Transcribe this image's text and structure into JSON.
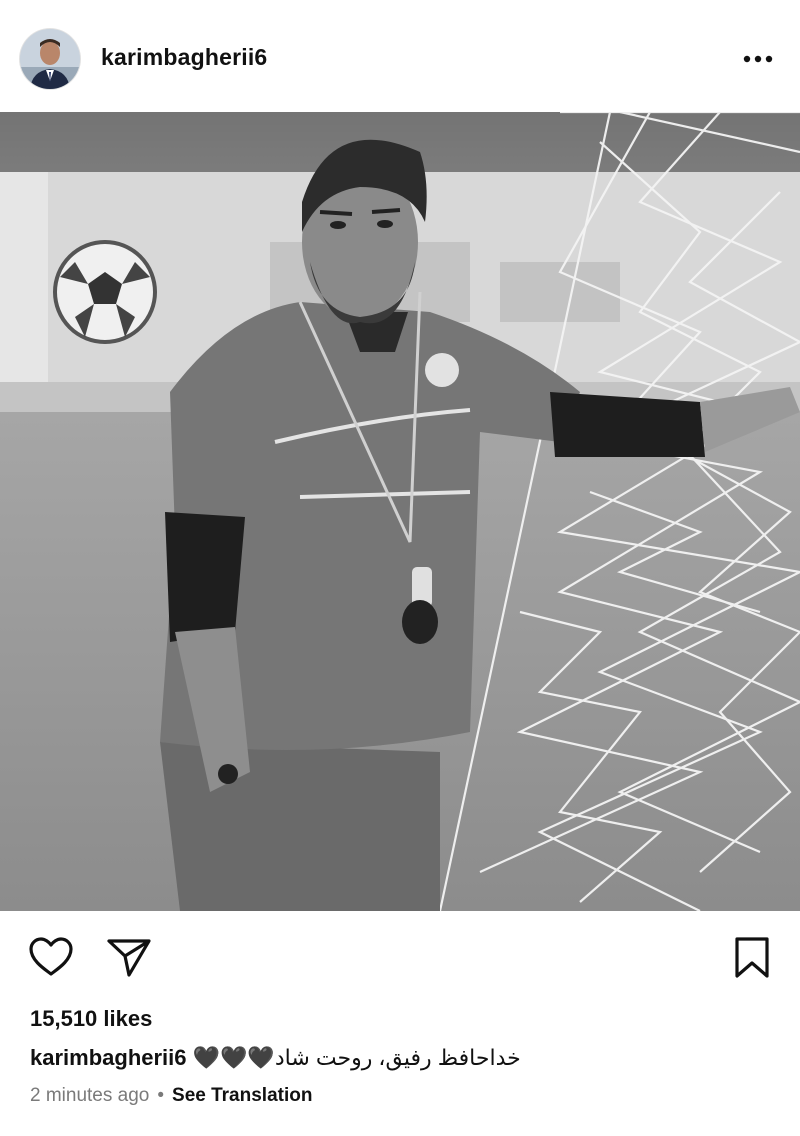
{
  "post": {
    "username": "karimbagherii6",
    "likes_text": "15,510 likes",
    "caption_username": "karimbagherii6",
    "caption_text": "خداحافظ رفیق، روحت شاد",
    "caption_emoji": "🖤🖤🖤",
    "timestamp": "2 minutes ago",
    "separator": "•",
    "see_translation": "See Translation"
  },
  "icons": {
    "more": "more-horizontal-icon",
    "like": "heart-icon",
    "share": "paper-plane-icon",
    "save": "bookmark-icon"
  },
  "colors": {
    "text": "#111111",
    "muted": "#7a7a7a",
    "background": "#ffffff"
  }
}
